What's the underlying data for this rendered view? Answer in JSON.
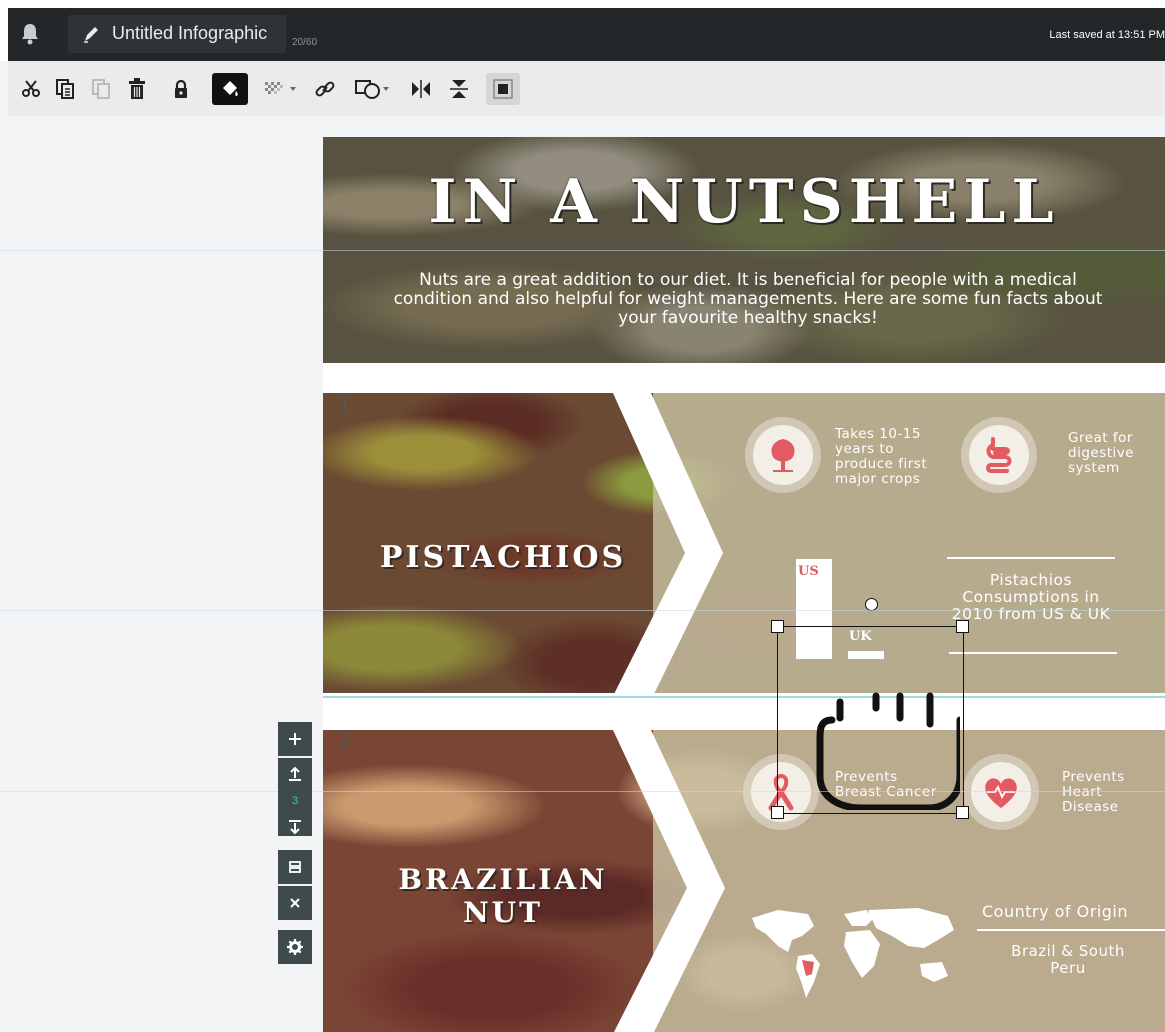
{
  "topbar": {
    "doc_title": "Untitled Infographic",
    "char_count": "20/60",
    "saved_text": "Last saved at 13:51 PM"
  },
  "toolbar": {
    "buttons": [
      "cut-icon",
      "copy-icon",
      "paste-icon",
      "delete-icon",
      "lock-icon",
      "fill-color-icon",
      "transparency-icon",
      "link-icon",
      "shape-icon",
      "flip-horizontal-icon",
      "flip-vertical-icon",
      "arrange-icon"
    ]
  },
  "canvas": {
    "title": "IN A NUTSHELL",
    "intro": "Nuts are a great addition to our diet. It is beneficial for people with a medical condition and also helpful for weight managements. Here are some fun facts about your favourite healthy snacks!",
    "sections": [
      {
        "number": "1",
        "name": "PISTACHIOS",
        "fact1": "Takes 10-15 years to produce first major crops",
        "fact2": "Great for digestive system",
        "stat_title": "Pistachios Consumptions in 2010 from US & UK",
        "chart_labels": [
          "US",
          "UK"
        ]
      },
      {
        "number": "2",
        "name_line1": "BRAZILIAN",
        "name_line2": "NUT",
        "fact1": "Prevents Breast Cancer",
        "fact2": "Prevents Heart Disease",
        "stat_title": "Country of Origin",
        "stat_value": "Brazil & South Peru"
      }
    ]
  },
  "side_panel": {
    "page_count": "3"
  },
  "colors": {
    "accent": "#e25b62",
    "topbar": "#24272a",
    "selection_border": "#9fdce3"
  }
}
